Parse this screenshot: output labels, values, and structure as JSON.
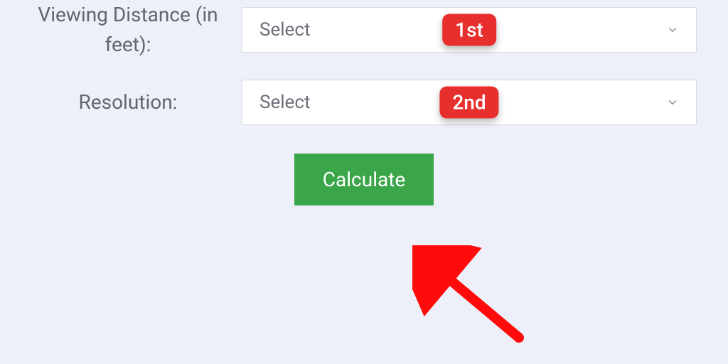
{
  "form": {
    "viewing_distance": {
      "label": "Viewing Distance (in feet):",
      "placeholder": "Select"
    },
    "resolution": {
      "label": "Resolution:",
      "placeholder": "Select"
    }
  },
  "annotations": {
    "badge1": "1st",
    "badge2": "2nd"
  },
  "buttons": {
    "calculate": "Calculate"
  },
  "colors": {
    "background": "#eef0f9",
    "badge": "#e7302e",
    "button": "#3ba54a",
    "arrow": "#ff0b0b",
    "label_text": "#62656e"
  }
}
